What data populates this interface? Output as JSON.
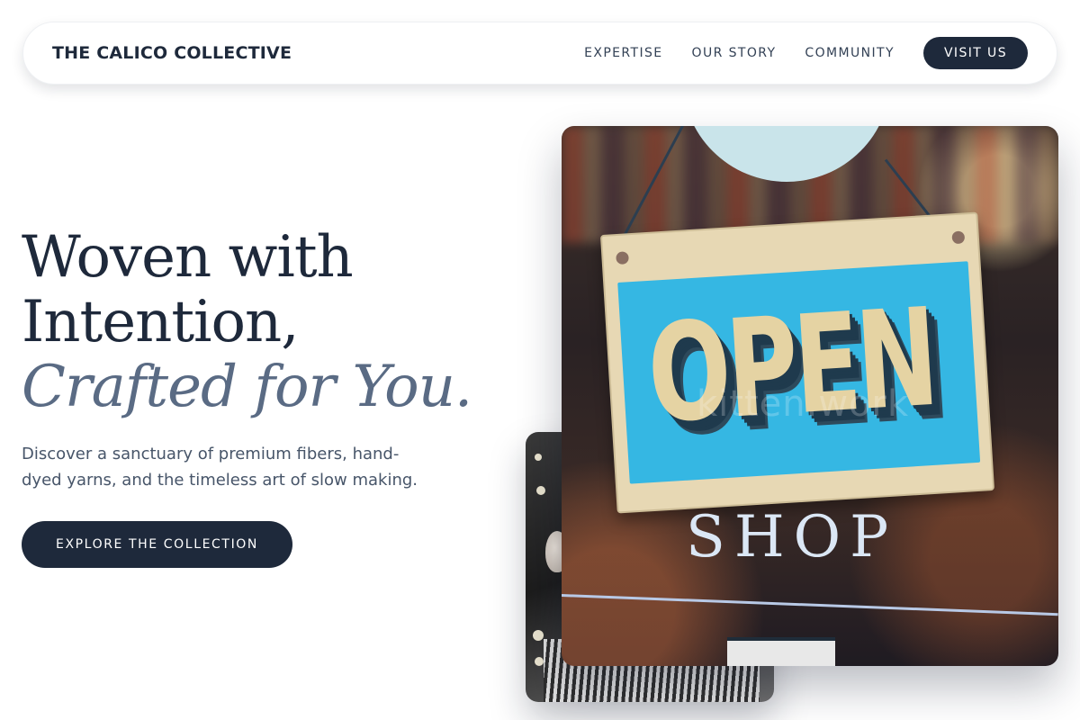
{
  "header": {
    "brand": "THE CALICO COLLECTIVE",
    "nav": [
      {
        "label": "EXPERTISE"
      },
      {
        "label": "OUR STORY"
      },
      {
        "label": "COMMUNITY"
      }
    ],
    "cta_label": "VISIT US"
  },
  "hero": {
    "headline_line1": "Woven with",
    "headline_line2": "Intention,",
    "headline_accent": "Crafted for You.",
    "description": "Discover a sanctuary of premium fibers, hand-dyed yarns, and the timeless art of slow making.",
    "cta_label": "EXPLORE THE COLLECTION"
  },
  "images": {
    "main": {
      "sign_text": "OPEN",
      "window_text": "SHOP",
      "watermark": "kitten.work",
      "icon": "open-shop-sign-photo"
    },
    "secondary": {
      "icon": "boutique-mannequin-photo"
    }
  },
  "colors": {
    "primary_dark": "#1e293b",
    "accent_text": "#5a6b84",
    "body_text": "#475569"
  }
}
